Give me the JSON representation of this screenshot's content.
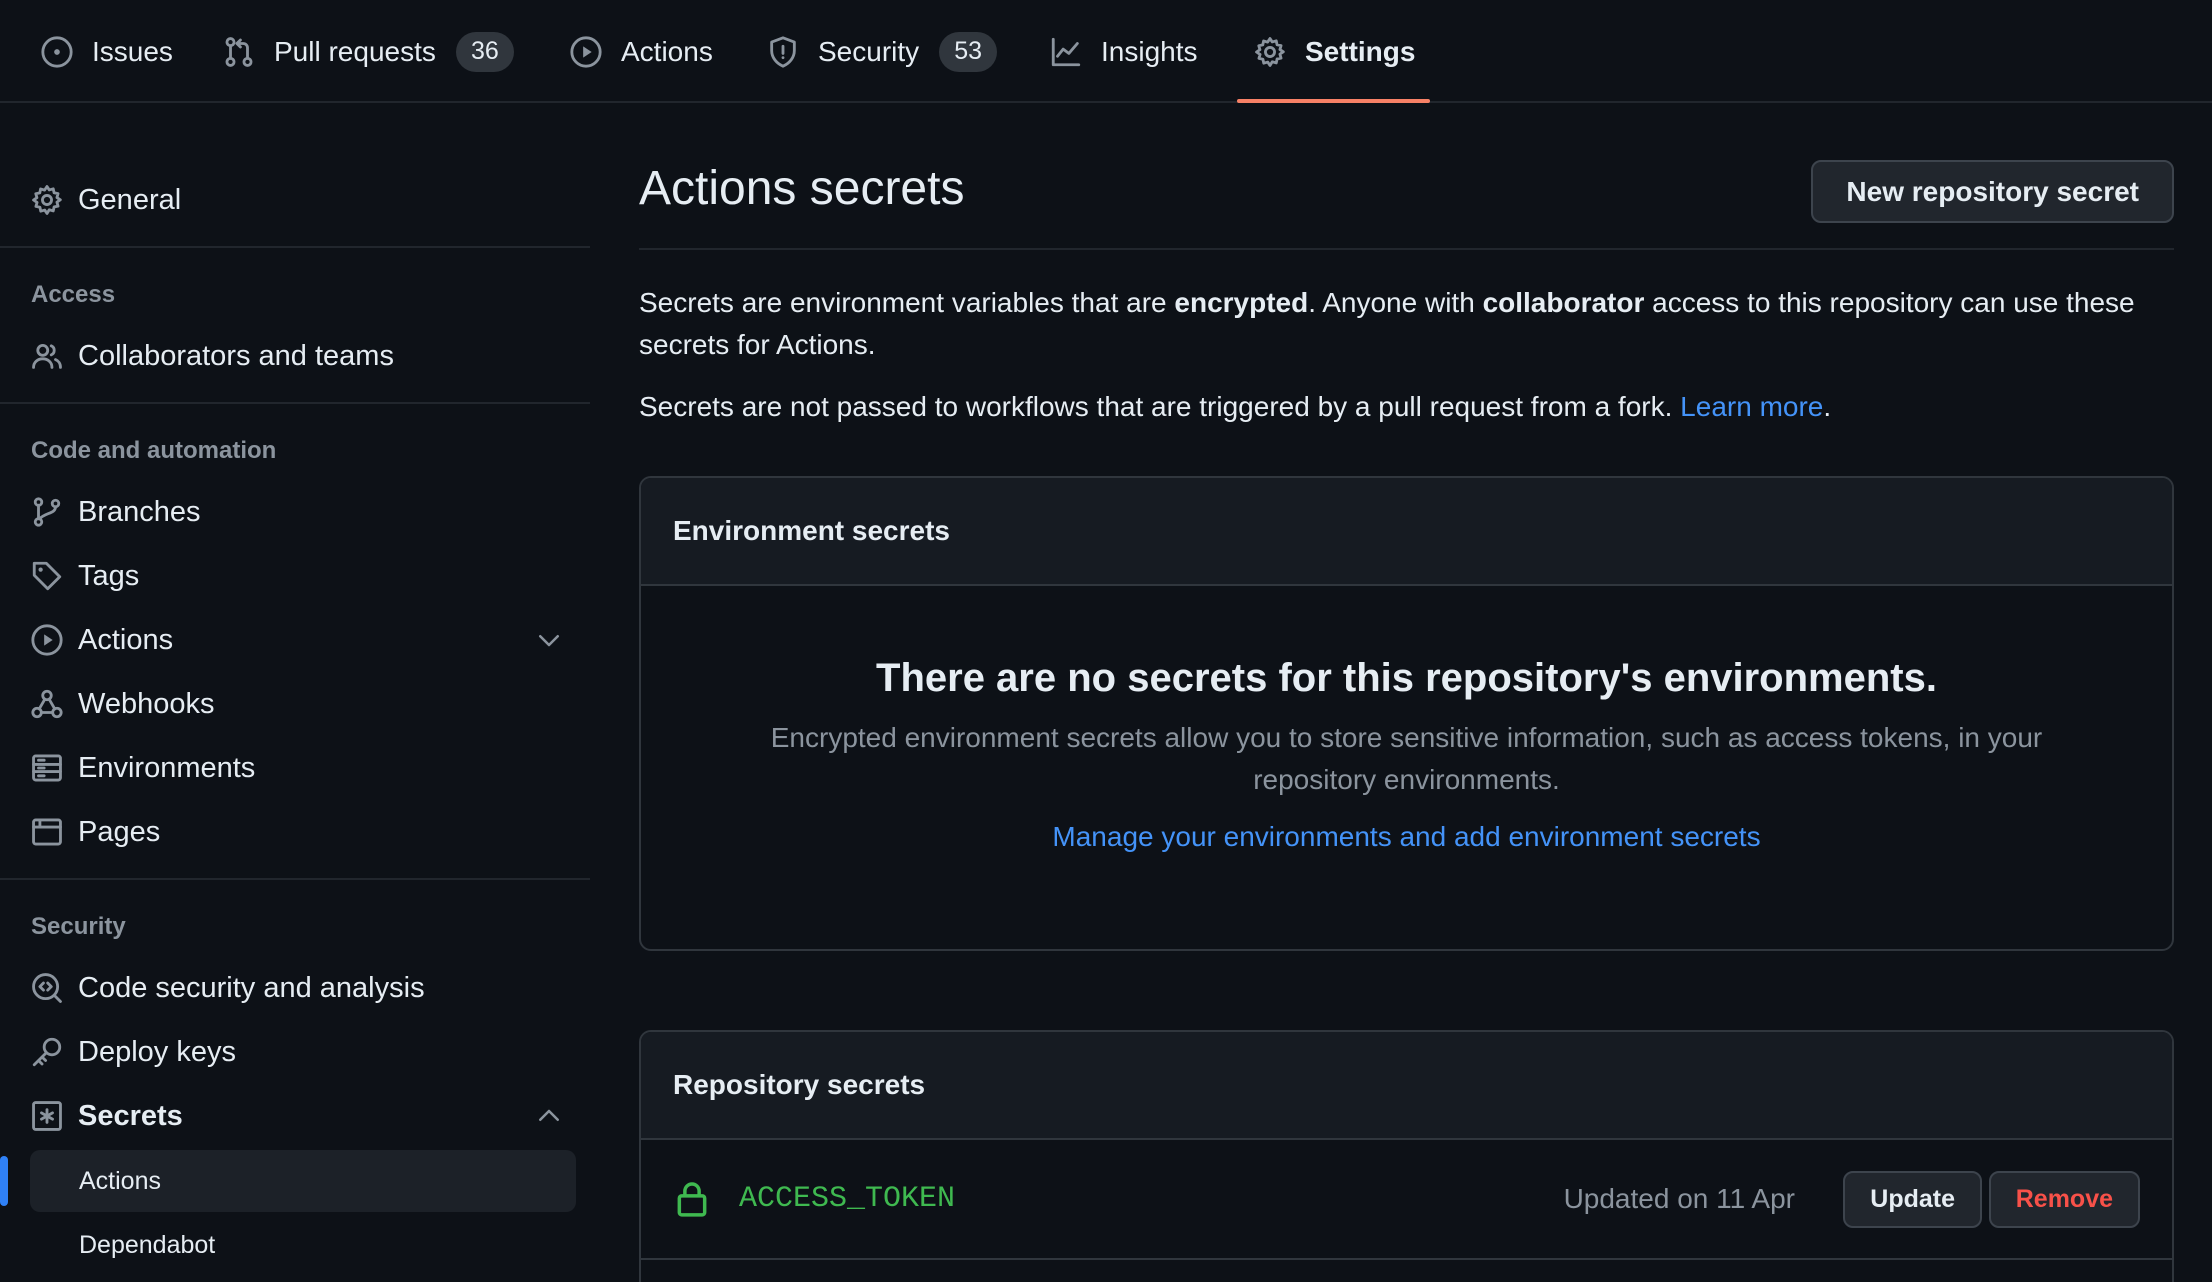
{
  "topnav": {
    "tabs": [
      {
        "label": "Issues",
        "icon": "issue-opened-icon"
      },
      {
        "label": "Pull requests",
        "icon": "git-pull-request-icon",
        "count": "36"
      },
      {
        "label": "Actions",
        "icon": "play-icon"
      },
      {
        "label": "Security",
        "icon": "shield-icon",
        "count": "53"
      },
      {
        "label": "Insights",
        "icon": "graph-icon"
      },
      {
        "label": "Settings",
        "icon": "gear-icon",
        "active": true
      }
    ],
    "accent_color": "#f78166"
  },
  "sidebar": {
    "general": "General",
    "sections": {
      "access": "Access",
      "code_automation": "Code and automation",
      "security": "Security"
    },
    "items": {
      "collaborators": "Collaborators and teams",
      "branches": "Branches",
      "tags": "Tags",
      "actions": "Actions",
      "webhooks": "Webhooks",
      "environments": "Environments",
      "pages": "Pages",
      "code_security": "Code security and analysis",
      "deploy_keys": "Deploy keys",
      "secrets": "Secrets"
    },
    "secrets_sub": {
      "actions": "Actions",
      "dependabot": "Dependabot"
    },
    "active_color": "#2f81f7"
  },
  "main": {
    "title": "Actions secrets",
    "new_button": "New repository secret",
    "desc1": {
      "a": "Secrets are environment variables that are ",
      "b": "encrypted",
      "c": ". Anyone with ",
      "d": "collaborator",
      "e": " access to this repository can use these secrets for Actions."
    },
    "desc2": {
      "text": "Secrets are not passed to workflows that are triggered by a pull request from a fork. ",
      "link": "Learn more",
      "end": "."
    },
    "environment_secrets": {
      "header": "Environment secrets",
      "blank_title": "There are no secrets for this repository's environments.",
      "blank_text": "Encrypted environment secrets allow you to store sensitive information, such as access tokens, in your repository environments.",
      "blank_link": "Manage your environments and add environment secrets"
    },
    "repository_secrets": {
      "header": "Repository secrets",
      "rows": [
        {
          "name": "ACCESS_TOKEN",
          "updated": "Updated on 11 Apr",
          "update_label": "Update",
          "remove_label": "Remove"
        }
      ]
    },
    "colors": {
      "link": "#4493f8",
      "secret_name": "#3fb950",
      "danger": "#f85149"
    }
  }
}
